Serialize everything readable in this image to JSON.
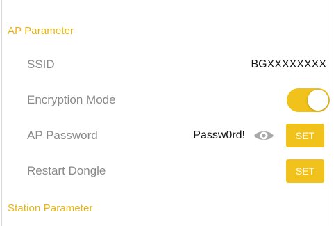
{
  "sections": {
    "ap": "AP Parameter",
    "station": "Station Parameter"
  },
  "rows": {
    "ssid": {
      "label": "SSID",
      "value": "BGXXXXXXXX"
    },
    "encryption": {
      "label": "Encryption Mode",
      "toggle_on": true
    },
    "password": {
      "label": "AP Password",
      "value": "Passw0rd!",
      "button": "SET"
    },
    "restart": {
      "label": "Restart Dongle",
      "button": "SET"
    }
  },
  "colors": {
    "accent": "#f1c21b",
    "header": "#e6b515",
    "label": "#8a8a8a"
  },
  "icons": {
    "password_visibility": "eye-icon"
  }
}
